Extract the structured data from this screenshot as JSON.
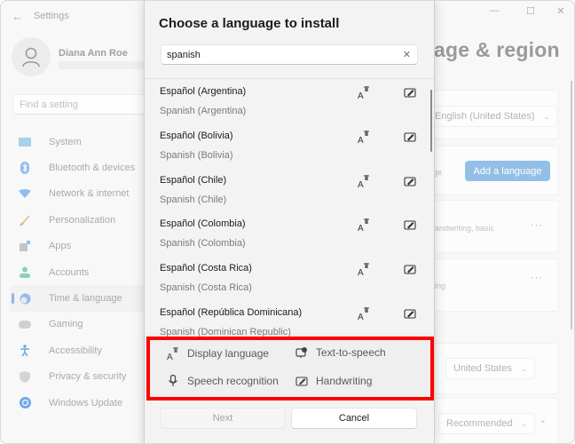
{
  "window": {
    "app_title": "Settings",
    "controls": {
      "minimize": "—",
      "maximize": "☐",
      "close": "✕"
    }
  },
  "profile": {
    "name": "Diana Ann Roe"
  },
  "sidebar": {
    "search_placeholder": "Find a setting",
    "items": [
      {
        "label": "System",
        "icon": "monitor-icon",
        "color": "#9ac6e6"
      },
      {
        "label": "Bluetooth & devices",
        "icon": "bluetooth-icon",
        "color": "#8fbdf0"
      },
      {
        "label": "Network & internet",
        "icon": "wifi-icon",
        "color": "#8fbdf0"
      },
      {
        "label": "Personalization",
        "icon": "brush-icon",
        "color": "#f0b680"
      },
      {
        "label": "Apps",
        "icon": "apps-icon",
        "color": "#b8b8b8"
      },
      {
        "label": "Accounts",
        "icon": "person-icon",
        "color": "#88d1c2"
      },
      {
        "label": "Time & language",
        "icon": "globe-clock-icon",
        "color": "#8fbdf0",
        "active": true
      },
      {
        "label": "Gaming",
        "icon": "gamepad-icon",
        "color": "#c8c8c8"
      },
      {
        "label": "Accessibility",
        "icon": "accessibility-icon",
        "color": "#8fbdf0"
      },
      {
        "label": "Privacy & security",
        "icon": "shield-icon",
        "color": "#d0d0d0"
      },
      {
        "label": "Windows Update",
        "icon": "update-icon",
        "color": "#8fbdf0"
      }
    ]
  },
  "content": {
    "title_partial": "age & region",
    "windows_display_language": "English (United States)",
    "preferred_languages_partial": "age",
    "add_language_label": "Add a language",
    "lang1_features_partial": "handwriting, basic",
    "lang2_features_partial": "ping",
    "more_label": "···",
    "country": "United States",
    "regional_format": "Recommended",
    "accent_color": "#93bfe6"
  },
  "dialog": {
    "title": "Choose a language to install",
    "search_value": "spanish",
    "clear_label": "✕",
    "languages": [
      {
        "native": "Español (Argentina)",
        "english": "Spanish (Argentina)"
      },
      {
        "native": "Español (Bolivia)",
        "english": "Spanish (Bolivia)"
      },
      {
        "native": "Español (Chile)",
        "english": "Spanish (Chile)"
      },
      {
        "native": "Español (Colombia)",
        "english": "Spanish (Colombia)"
      },
      {
        "native": "Español (Costa Rica)",
        "english": "Spanish (Costa Rica)"
      },
      {
        "native": "Español (República Dominicana)",
        "english": "Spanish (Dominican Republic)"
      }
    ],
    "legend": {
      "display_language": "Display language",
      "text_to_speech": "Text-to-speech",
      "speech_recognition": "Speech recognition",
      "handwriting": "Handwriting"
    },
    "next_label": "Next",
    "cancel_label": "Cancel",
    "highlight_color": "#ff0000"
  }
}
